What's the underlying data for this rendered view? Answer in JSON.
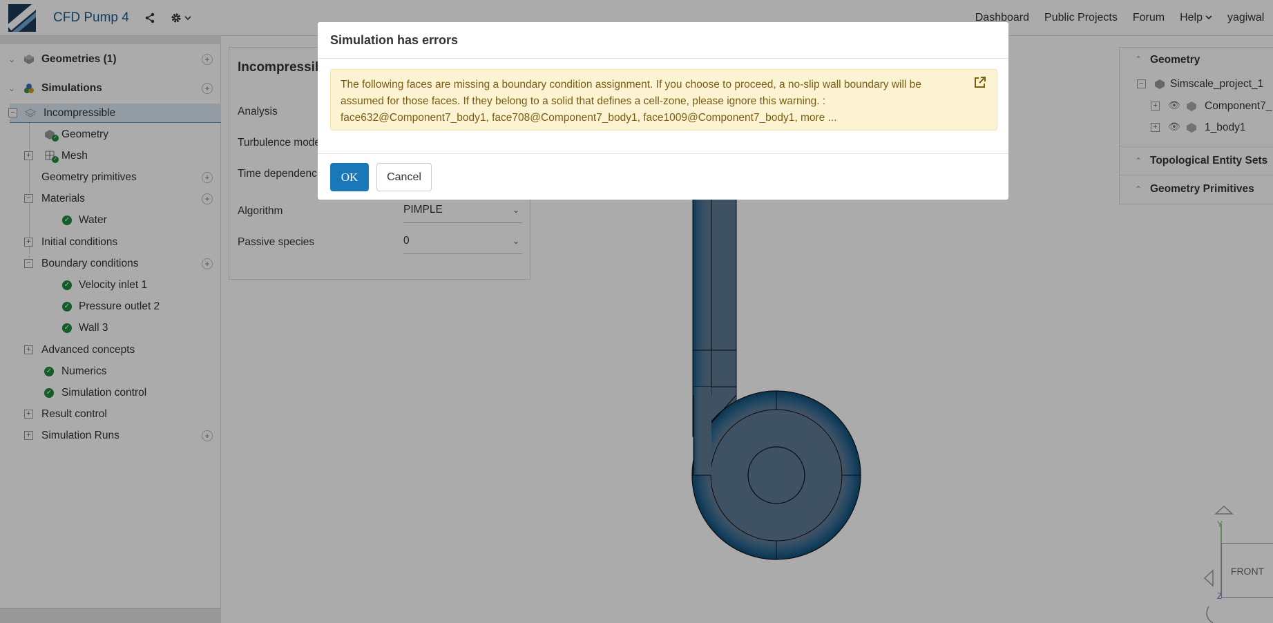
{
  "topbar": {
    "project_title": "CFD Pump 4",
    "nav": [
      "Dashboard",
      "Public Projects",
      "Forum",
      "Help"
    ],
    "user": "yagiwal"
  },
  "tree": {
    "geometries": "Geometries (1)",
    "simulations": "Simulations",
    "incompressible": "Incompressible",
    "geometry": "Geometry",
    "mesh": "Mesh",
    "geometry_primitives": "Geometry primitives",
    "materials": "Materials",
    "water": "Water",
    "initial_conditions": "Initial conditions",
    "boundary_conditions": "Boundary conditions",
    "velocity_inlet": "Velocity inlet 1",
    "pressure_outlet": "Pressure outlet 2",
    "wall": "Wall 3",
    "advanced_concepts": "Advanced concepts",
    "numerics": "Numerics",
    "simulation_control": "Simulation control",
    "result_control": "Result control",
    "simulation_runs": "Simulation Runs"
  },
  "settings": {
    "title": "Incompressibl",
    "analysis_label": "Analysis",
    "turbulence_label": "Turbulence mode",
    "time_label": "Time dependenc",
    "algorithm_label": "Algorithm",
    "algorithm_value": "PIMPLE",
    "passive_label": "Passive species",
    "passive_value": "0"
  },
  "right_panel": {
    "geometry": "Geometry",
    "project": "Simscale_project_1",
    "component": "Component7_",
    "body": "1_body1",
    "topological": "Topological Entity Sets",
    "primitives": "Geometry Primitives"
  },
  "modal": {
    "title": "Simulation has errors",
    "message_line1": "The following faces are missing a boundary condition assignment. If you choose to proceed, a no-slip wall boundary will be",
    "message_line2": "assumed for those faces. If they belong to a solid that defines a cell-zone, please ignore this warning. :",
    "message_line3": "face632@Component7_body1, face708@Component7_body1, face1009@Component7_body1, more ...",
    "ok": "OK",
    "cancel": "Cancel"
  },
  "viewcube": {
    "face": "FRONT",
    "axis_y": "Y",
    "axis_z": "Z"
  },
  "colors": {
    "accent": "#1a78b8",
    "success": "#1e8a3c",
    "warning_bg": "#fbf3d2",
    "warning_text": "#7a5c12",
    "model_fill": "#5f7b94",
    "model_edge": "#0d4f7a"
  }
}
